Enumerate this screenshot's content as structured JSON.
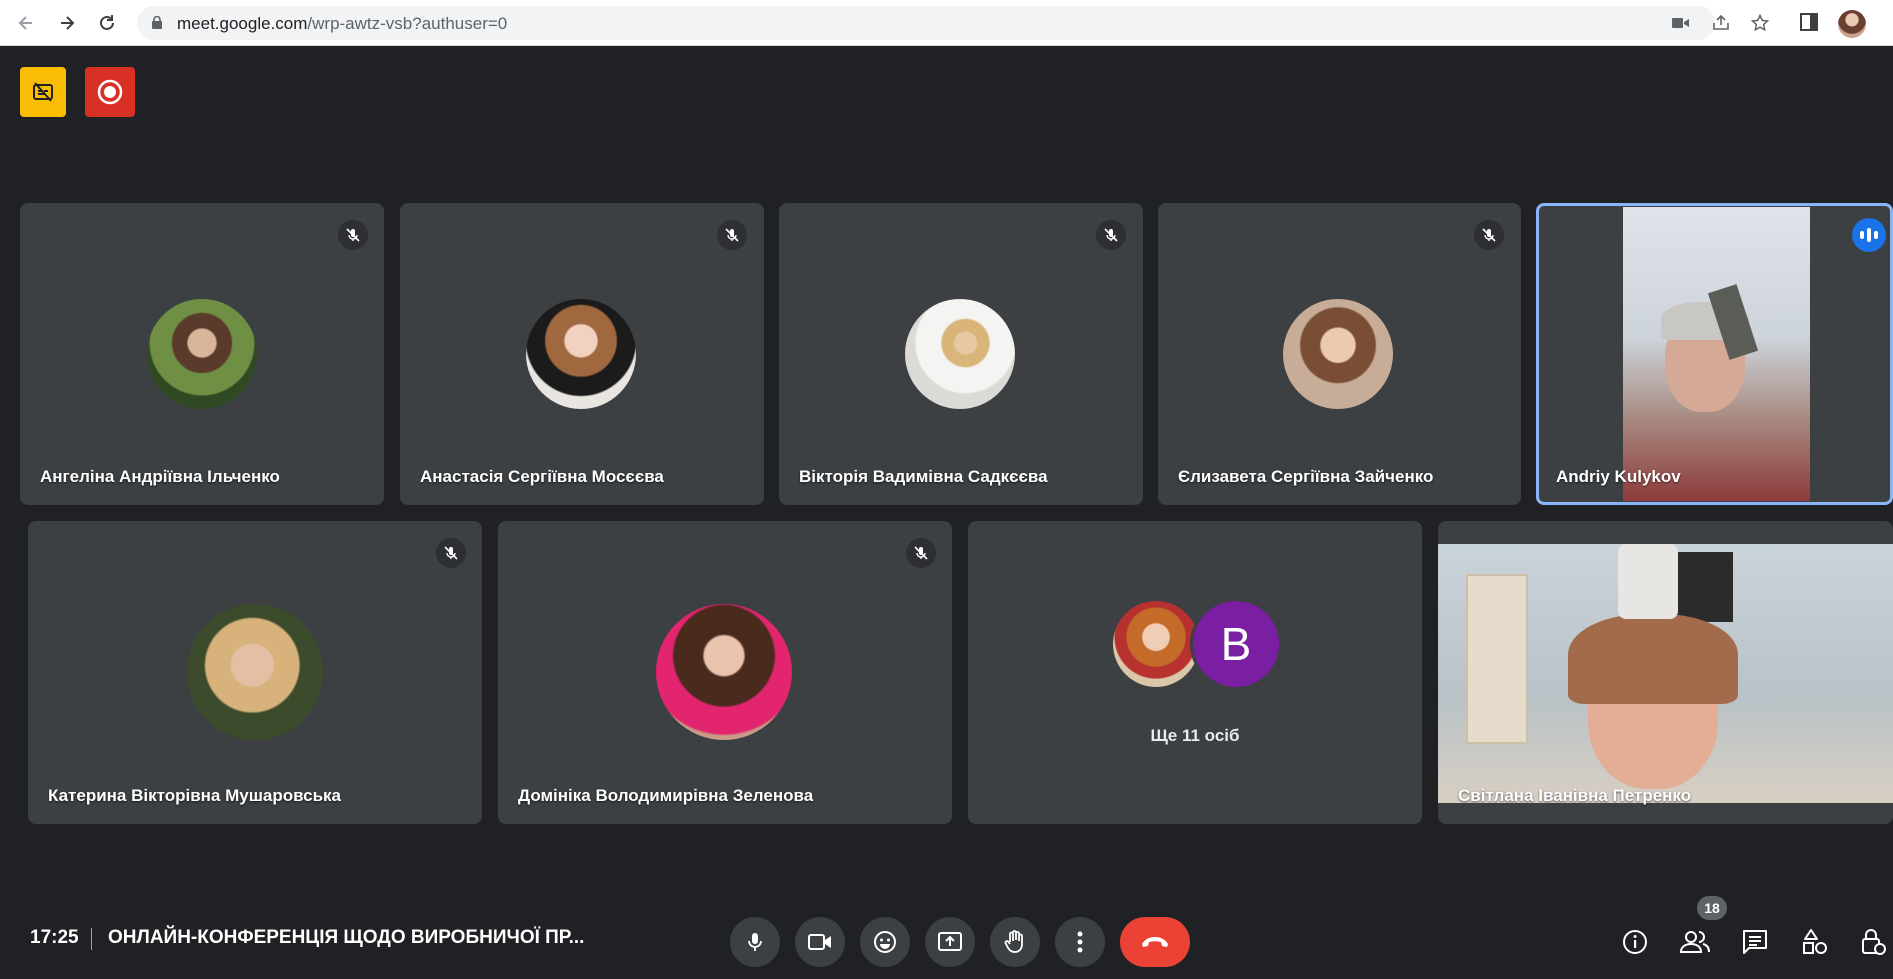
{
  "browser": {
    "url_host": "meet.google.com",
    "url_path": "/wrp-awtz-vsb?authuser=0"
  },
  "participants": [
    {
      "name": "Ангеліна Андріївна Ільченко",
      "muted": true
    },
    {
      "name": "Анастасія Сергіївна Мосєєва",
      "muted": true
    },
    {
      "name": "Вікторія Вадимівна Садкєєва",
      "muted": true
    },
    {
      "name": "Єлизавета Сергіївна Зайченко",
      "muted": true
    },
    {
      "name": "Andriy Kulykov",
      "speaking": true
    },
    {
      "name": "Катерина Вікторівна Мушаровська",
      "muted": true
    },
    {
      "name": "Домініка Володимирівна Зеленова",
      "muted": true
    },
    {
      "name": "Світлана Іванівна Петренко"
    }
  ],
  "others_tile": {
    "label": "Ще 11 осіб",
    "avatar_letter": "B"
  },
  "bottom": {
    "time": "17:25",
    "meeting_title": "ОНЛАЙН-КОНФЕРЕНЦІЯ ЩОДО ВИРОБНИЧОЇ ПР...",
    "people_count": "18"
  },
  "icons": {
    "badges": [
      "captions-off-icon",
      "recording-icon"
    ],
    "controls": [
      "mic-icon",
      "camera-icon",
      "emoji-icon",
      "present-screen-icon",
      "raise-hand-icon",
      "more-options-icon",
      "end-call-icon"
    ],
    "right": [
      "meeting-details-icon",
      "people-icon",
      "chat-icon",
      "activities-icon",
      "host-controls-icon"
    ]
  },
  "colors": {
    "background": "#202124",
    "tile": "#3c4043",
    "end_call": "#ea4335",
    "speaking": "#1a73e8",
    "active_outline": "#8ab4f8",
    "badge_yellow": "#fbbc04",
    "badge_red": "#d93025",
    "avatar_purple": "#7b1fa2"
  }
}
